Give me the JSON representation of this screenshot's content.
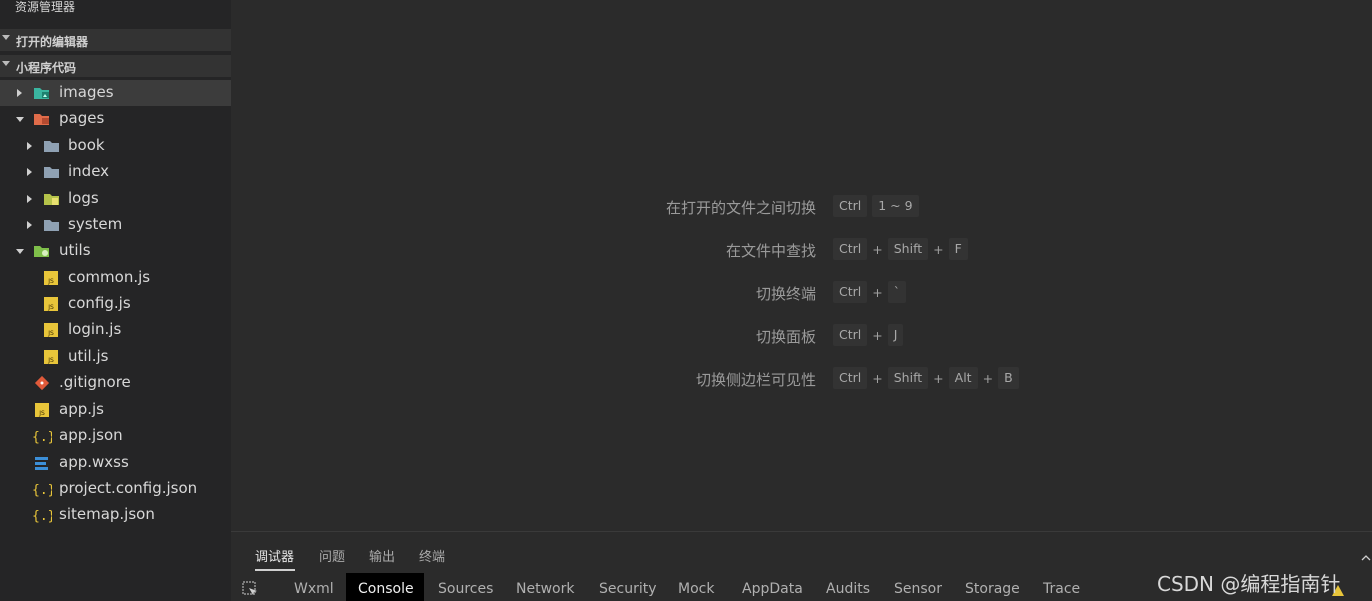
{
  "sidebar": {
    "title": "资源管理器",
    "sections": {
      "open_editors": "打开的编辑器",
      "project": "小程序代码"
    },
    "tree": {
      "images": "images",
      "pages": "pages",
      "book": "book",
      "index": "index",
      "logs": "logs",
      "system": "system",
      "utils": "utils",
      "common_js": "common.js",
      "config_js": "config.js",
      "login_js": "login.js",
      "util_js": "util.js",
      "gitignore": ".gitignore",
      "app_js": "app.js",
      "app_json": "app.json",
      "app_wxss": "app.wxss",
      "project_config_json": "project.config.json",
      "sitemap_json": "sitemap.json"
    }
  },
  "shortcuts": [
    {
      "label": "在打开的文件之间切换",
      "keys": [
        "Ctrl",
        "1 ~ 9"
      ],
      "sep": ""
    },
    {
      "label": "在文件中查找",
      "keys": [
        "Ctrl",
        "Shift",
        "F"
      ],
      "sep": "+"
    },
    {
      "label": "切换终端",
      "keys": [
        "Ctrl",
        "`"
      ],
      "sep": "+"
    },
    {
      "label": "切换面板",
      "keys": [
        "Ctrl",
        "J"
      ],
      "sep": "+"
    },
    {
      "label": "切换侧边栏可见性",
      "keys": [
        "Ctrl",
        "Shift",
        "Alt",
        "B"
      ],
      "sep": "+"
    }
  ],
  "panel": {
    "tabs": {
      "debugger": "调试器",
      "problems": "问题",
      "output": "输出",
      "terminal": "终端"
    },
    "devtools_tabs": {
      "wxml": "Wxml",
      "console": "Console",
      "sources": "Sources",
      "network": "Network",
      "security": "Security",
      "mock": "Mock",
      "appdata": "AppData",
      "audits": "Audits",
      "sensor": "Sensor",
      "storage": "Storage",
      "trace": "Trace"
    }
  },
  "watermark": "CSDN @编程指南针",
  "colors": {
    "js_icon": "#e8c53a",
    "json_icon": "#e8c53a",
    "css_icon": "#3c8fd8",
    "git_icon": "#e05a3a",
    "folder": "#8fa1b3",
    "pages_folder": "#e06c4a",
    "images_folder": "#3ab5a0",
    "utils_folder": "#7fbf4a"
  }
}
